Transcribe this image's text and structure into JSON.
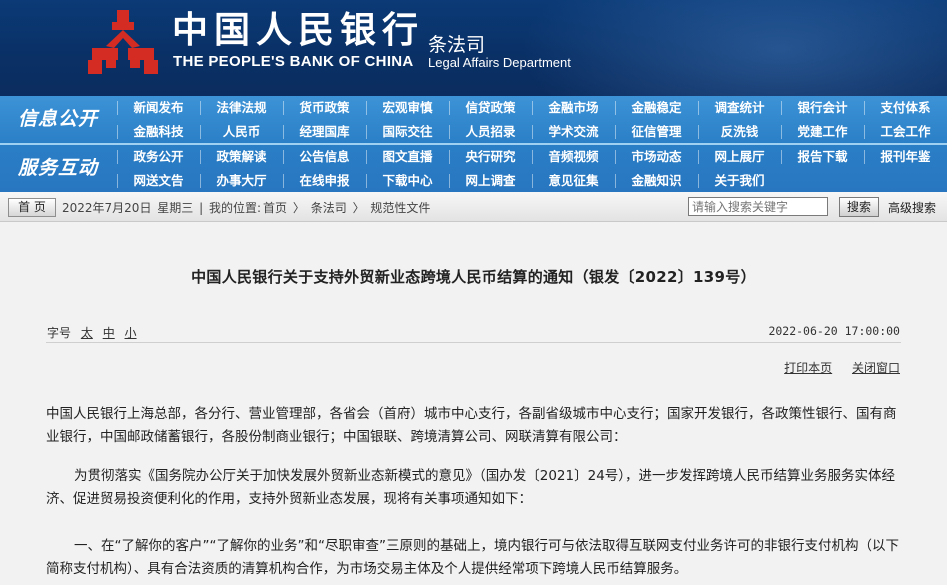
{
  "header": {
    "bank_name_cn": "中国人民银行",
    "bank_name_en": "THE PEOPLE'S BANK OF CHINA",
    "dept_cn": "条法司",
    "dept_en": "Legal Affairs Department",
    "logo_color": "#d42c22"
  },
  "nav": {
    "group1_label": "信息公开",
    "group2_label": "服务互动",
    "rows": [
      [
        "新闻发布",
        "法律法规",
        "货币政策",
        "宏观审慎",
        "信贷政策",
        "金融市场",
        "金融稳定",
        "调查统计",
        "银行会计",
        "支付体系"
      ],
      [
        "金融科技",
        "人民币",
        "经理国库",
        "国际交往",
        "人员招录",
        "学术交流",
        "征信管理",
        "反洗钱",
        "党建工作",
        "工会工作"
      ],
      [
        "政务公开",
        "政策解读",
        "公告信息",
        "图文直播",
        "央行研究",
        "音频视频",
        "市场动态",
        "网上展厅",
        "报告下载",
        "报刊年鉴"
      ],
      [
        "网送文告",
        "办事大厅",
        "在线申报",
        "下载中心",
        "网上调查",
        "意见征集",
        "金融知识",
        "关于我们"
      ]
    ]
  },
  "breadcrumb": {
    "home_label": "首 页",
    "date": "2022年7月20日",
    "weekday": "星期三",
    "location_prefix": "我的位置:",
    "path": [
      "首页",
      "条法司",
      "规范性文件"
    ]
  },
  "search": {
    "placeholder": "请输入搜索关键字",
    "button_label": "搜索",
    "advanced_label": "高级搜索"
  },
  "article": {
    "title": "中国人民银行关于支持外贸新业态跨境人民币结算的通知（银发〔2022〕139号）",
    "font_size_label": "字号",
    "font_sizes": [
      "太",
      "中",
      "小"
    ],
    "pub_datetime": "2022-06-20 17:00:00",
    "print_label": "打印本页",
    "close_label": "关闭窗口",
    "paragraphs": [
      "中国人民银行上海总部，各分行、营业管理部，各省会（首府）城市中心支行，各副省级城市中心支行；国家开发银行，各政策性银行、国有商业银行，中国邮政储蓄银行，各股份制商业银行；中国银联、跨境清算公司、网联清算有限公司：",
      "为贯彻落实《国务院办公厅关于加快发展外贸新业态新模式的意见》（国办发〔2021〕24号），进一步发挥跨境人民币结算业务服务实体经济、促进贸易投资便利化的作用，支持外贸新业态发展，现将有关事项通知如下：",
      "一、在“了解你的客户”“了解你的业务”和“尽职审查”三原则的基础上，境内银行可与依法取得互联网支付业务许可的非银行支付机构（以下简称支付机构）、具有合法资质的清算机构合作，为市场交易主体及个人提供经常项下跨境人民币结算服务。"
    ]
  }
}
